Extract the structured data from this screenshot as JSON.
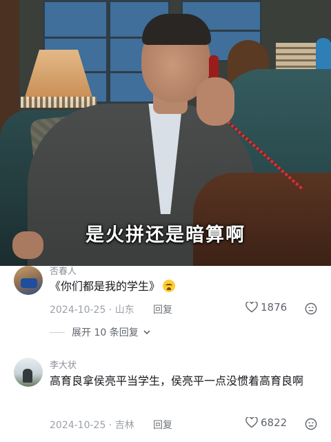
{
  "video": {
    "subtitle": "是火拼还是暗算啊"
  },
  "comments": [
    {
      "username": "否春人",
      "text": "《你们都是我的学生》",
      "emoji": "crying-face-emoji",
      "date_location": "2024-10-25 · 山东",
      "reply_label": "回复",
      "likes": "1876",
      "expand_label": "展开 10 条回复"
    },
    {
      "username": "李大状",
      "text": "高育良拿侯亮平当学生，侯亮平一点没惯着高育良啊",
      "date_location": "2024-10-25 · 吉林",
      "reply_label": "回复",
      "likes": "6822"
    }
  ],
  "colors": {
    "meta_gray": "#9aa0a8",
    "text_dark": "#16181c"
  }
}
